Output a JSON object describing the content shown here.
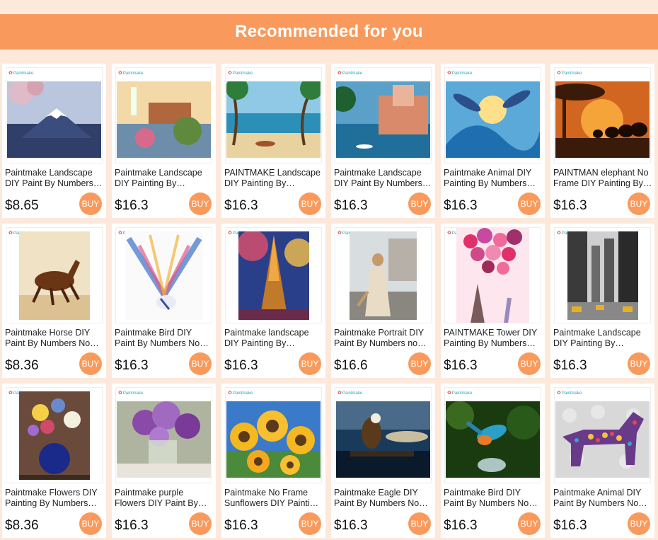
{
  "header": {
    "title": "Recommended for you"
  },
  "brand": "Paintmake",
  "buy_label": "BUY",
  "products": [
    {
      "title": "Paintmake Landscape DIY Paint By Numbers Modern Wall Art",
      "price": "$8.65",
      "image": "mount-fuji-painting"
    },
    {
      "title": "Paintmake Landscape DIY Painting By Numbers Lighthouse",
      "price": "$16.3",
      "image": "lighthouse-cottage-painting"
    },
    {
      "title": "PAINTMAKE Landscape DIY Painting By Numbers Beach",
      "price": "$16.3",
      "image": "tropical-beach-painting"
    },
    {
      "title": "Paintmake Landscape DIY Paint By Numbers Seaside Town",
      "price": "$16.3",
      "image": "seaside-village-painting"
    },
    {
      "title": "Paintmake Animal DIY Painting By Numbers Dolphins",
      "price": "$16.3",
      "image": "dolphins-painting"
    },
    {
      "title": "PAINTMAN elephant No Frame DIY Painting By Numbers",
      "price": "$16.3",
      "image": "elephants-sunset-painting"
    },
    {
      "title": "Paintmake Horse DIY Paint By Numbers No Frame",
      "price": "$8.36",
      "image": "running-horse-painting"
    },
    {
      "title": "Paintmake Bird DIY Paint By Numbers No Frame",
      "price": "$16.3",
      "image": "colorful-bird-painting"
    },
    {
      "title": "Paintmake landscape DIY Painting By Numbers Eiffel Tower",
      "price": "$16.3",
      "image": "eiffel-tower-painting"
    },
    {
      "title": "Paintmake Portrait DIY Paint By Numbers no Frame",
      "price": "$16.6",
      "image": "woman-portrait-painting"
    },
    {
      "title": "PAINTMAKE Tower DIY Painting By Numbers Balloons",
      "price": "$16.3",
      "image": "balloons-tower-painting"
    },
    {
      "title": "Paintmake Landscape DIY Painting By Numbers City",
      "price": "$16.3",
      "image": "city-street-painting"
    },
    {
      "title": "Paintmake Flowers DIY Painting By Numbers Vase",
      "price": "$8.36",
      "image": "flower-vase-painting"
    },
    {
      "title": "Paintmake purple Flowers DIY Paint By Numbers",
      "price": "$16.3",
      "image": "purple-flowers-painting"
    },
    {
      "title": "Paintmake No Frame Sunflowers DIY Painting By Numbers",
      "price": "$16.3",
      "image": "sunflowers-painting"
    },
    {
      "title": "Paintmake Eagle DIY Paint By Numbers No Frame",
      "price": "$16.3",
      "image": "eagle-painting"
    },
    {
      "title": "Paintmake Bird DIY Paint By Numbers No Frame",
      "price": "$16.3",
      "image": "kingfisher-painting"
    },
    {
      "title": "Paintmake Animal DIY Paint By Numbers No Frame",
      "price": "$16.3",
      "image": "mosaic-dog-painting"
    }
  ],
  "colors": {
    "page_bg": "#fde9dc",
    "accent": "#f99a5c",
    "header_text": "#ffffff"
  }
}
